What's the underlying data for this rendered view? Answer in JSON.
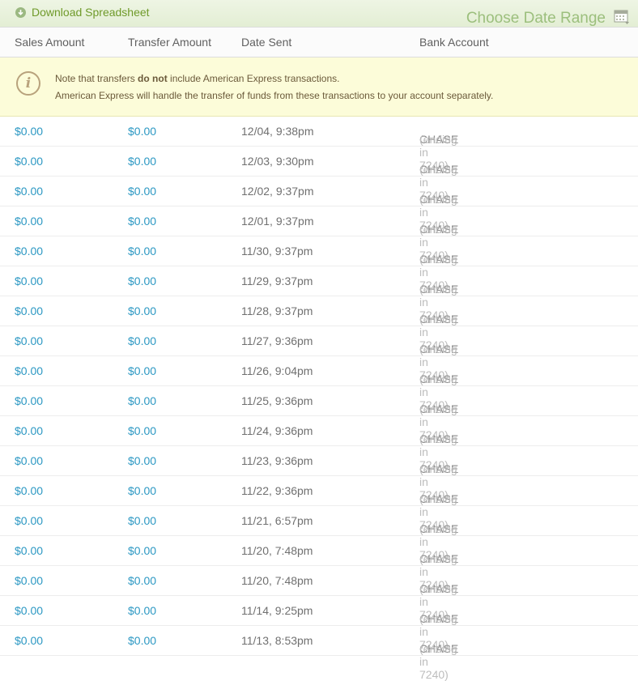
{
  "toolbar": {
    "download_label": "Download Spreadsheet",
    "date_range_label": "Choose Date Range"
  },
  "columns": [
    "Sales Amount",
    "Transfer Amount",
    "Date Sent",
    "Bank Account"
  ],
  "notice": {
    "line1_before": "Note that transfers ",
    "line1_bold": "do not",
    "line1_after": " include American Express transactions.",
    "line2": "American Express will handle the transfer of funds from these transactions to your account separately."
  },
  "rows": [
    {
      "sales": "$0.00",
      "transfer": "$0.00",
      "date": "12/04, 9:38pm",
      "bank": "CHASE",
      "ending": "(ending in 7240)"
    },
    {
      "sales": "$0.00",
      "transfer": "$0.00",
      "date": "12/03, 9:30pm",
      "bank": "CHASE",
      "ending": "(ending in 7240)"
    },
    {
      "sales": "$0.00",
      "transfer": "$0.00",
      "date": "12/02, 9:37pm",
      "bank": "CHASE",
      "ending": "(ending in 7240)"
    },
    {
      "sales": "$0.00",
      "transfer": "$0.00",
      "date": "12/01, 9:37pm",
      "bank": "CHASE",
      "ending": "(ending in 7240)"
    },
    {
      "sales": "$0.00",
      "transfer": "$0.00",
      "date": "11/30, 9:37pm",
      "bank": "CHASE",
      "ending": "(ending in 7240)"
    },
    {
      "sales": "$0.00",
      "transfer": "$0.00",
      "date": "11/29, 9:37pm",
      "bank": "CHASE",
      "ending": "(ending in 7240)"
    },
    {
      "sales": "$0.00",
      "transfer": "$0.00",
      "date": "11/28, 9:37pm",
      "bank": "CHASE",
      "ending": "(ending in 7240)"
    },
    {
      "sales": "$0.00",
      "transfer": "$0.00",
      "date": "11/27, 9:36pm",
      "bank": "CHASE",
      "ending": "(ending in 7240)"
    },
    {
      "sales": "$0.00",
      "transfer": "$0.00",
      "date": "11/26, 9:04pm",
      "bank": "CHASE",
      "ending": "(ending in 7240)"
    },
    {
      "sales": "$0.00",
      "transfer": "$0.00",
      "date": "11/25, 9:36pm",
      "bank": "CHASE",
      "ending": "(ending in 7240)"
    },
    {
      "sales": "$0.00",
      "transfer": "$0.00",
      "date": "11/24, 9:36pm",
      "bank": "CHASE",
      "ending": "(ending in 7240)"
    },
    {
      "sales": "$0.00",
      "transfer": "$0.00",
      "date": "11/23, 9:36pm",
      "bank": "CHASE",
      "ending": "(ending in 7240)"
    },
    {
      "sales": "$0.00",
      "transfer": "$0.00",
      "date": "11/22, 9:36pm",
      "bank": "CHASE",
      "ending": "(ending in 7240)"
    },
    {
      "sales": "$0.00",
      "transfer": "$0.00",
      "date": "11/21, 6:57pm",
      "bank": "CHASE",
      "ending": "(ending in 7240)"
    },
    {
      "sales": "$0.00",
      "transfer": "$0.00",
      "date": "11/20, 7:48pm",
      "bank": "CHASE",
      "ending": "(ending in 7240)"
    },
    {
      "sales": "$0.00",
      "transfer": "$0.00",
      "date": "11/20, 7:48pm",
      "bank": "CHASE",
      "ending": "(ending in 7240)"
    },
    {
      "sales": "$0.00",
      "transfer": "$0.00",
      "date": "11/14, 9:25pm",
      "bank": "CHASE",
      "ending": "(ending in 7240)"
    },
    {
      "sales": "$0.00",
      "transfer": "$0.00",
      "date": "11/13, 8:53pm",
      "bank": "CHASE",
      "ending": "(ending in 7240)"
    }
  ],
  "icons": {
    "download": "download-circle-icon",
    "calendar": "calendar-icon",
    "info": "info-icon"
  },
  "colors": {
    "accent_green": "#6f9a2a",
    "link_blue": "#2c98c3",
    "notice_bg": "#fcfcd9"
  }
}
